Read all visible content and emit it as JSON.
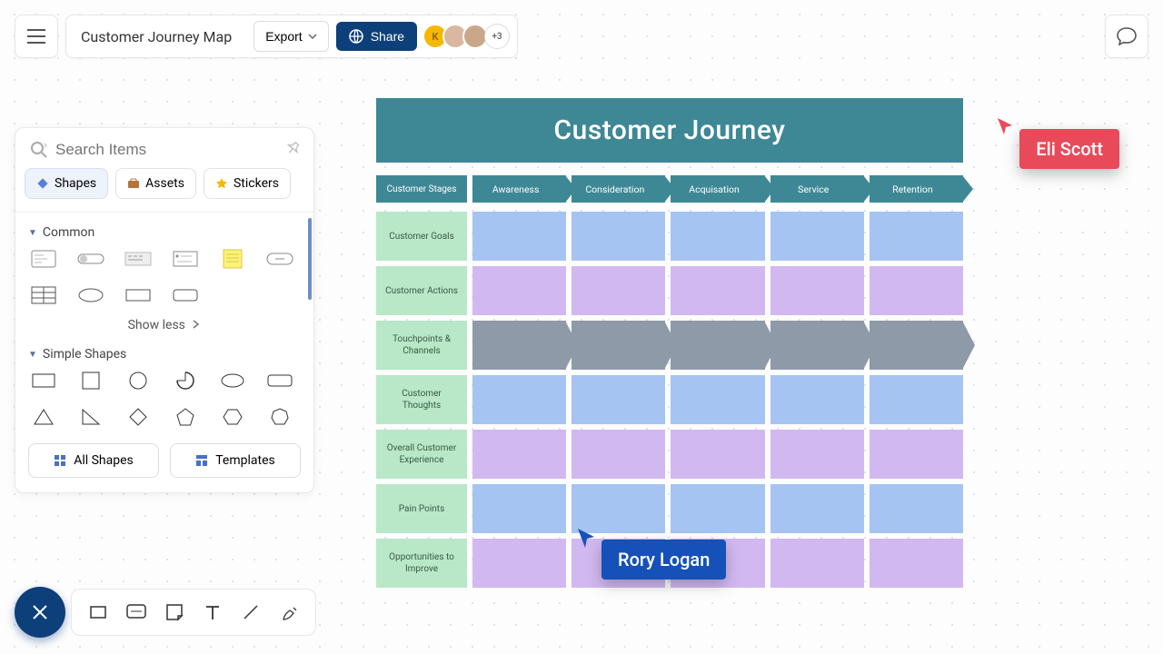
{
  "header": {
    "doc_title": "Customer Journey Map",
    "export_label": "Export",
    "share_label": "Share",
    "avatar_initial": "K",
    "avatar_overflow": "+3"
  },
  "search": {
    "placeholder": "Search Items"
  },
  "tabs": {
    "shapes": "Shapes",
    "assets": "Assets",
    "stickers": "Stickers"
  },
  "sections": {
    "common": "Common",
    "simple": "Simple Shapes",
    "show_less": "Show less"
  },
  "buttons": {
    "all_shapes": "All Shapes",
    "templates": "Templates"
  },
  "diagram": {
    "title": "Customer Journey",
    "stage_header": "Customer Stages",
    "stages": [
      "Awareness",
      "Consideration",
      "Acquisation",
      "Service",
      "Retention"
    ],
    "rows": [
      {
        "label": "Customer Goals",
        "style": "blue"
      },
      {
        "label": "Customer Actions",
        "style": "purple"
      },
      {
        "label": "Touchpoints & Channels",
        "style": "arrow"
      },
      {
        "label": "Customer Thoughts",
        "style": "blue"
      },
      {
        "label": "Overall Customer Experience",
        "style": "purple"
      },
      {
        "label": "Pain Points",
        "style": "blue"
      },
      {
        "label": "Opportunities to Improve",
        "style": "purple"
      }
    ]
  },
  "cursors": {
    "eli": "Eli Scott",
    "rory": "Rory Logan"
  }
}
